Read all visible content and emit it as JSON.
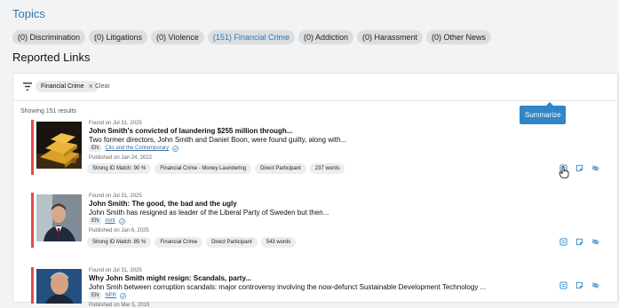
{
  "topics": {
    "title": "Topics",
    "chips": [
      {
        "label": "(0) Discrimination",
        "active": false
      },
      {
        "label": "(0) Litigations",
        "active": false
      },
      {
        "label": "(0) Violence",
        "active": false
      },
      {
        "label": "(151) Financial Crime",
        "active": true
      },
      {
        "label": "(0) Addiction",
        "active": false
      },
      {
        "label": "(0) Harassment",
        "active": false
      },
      {
        "label": "(0) Other News",
        "active": false
      }
    ]
  },
  "links": {
    "title": "Reported Links",
    "filter": {
      "tag": "Financial Crime",
      "clear_label": "Clear"
    },
    "count_text": "Showing 151 results",
    "tooltip": "Summarize",
    "cards": [
      {
        "found": "Found on Jul 31, 2025",
        "title": "John Smith's convicted of laundering $255 million through...",
        "summary": "Two former directors, John Smith and Daniel Boon, were found guilty, along with...",
        "lang": "EN",
        "source": "Clio and the Contemporary",
        "published": "Published on Jan 24, 2022",
        "tags": [
          "Strong ID Match: 90 %",
          "Financial Crime - Money Laundering",
          "Direct Participant",
          "237 words"
        ]
      },
      {
        "found": "Found on Jul 31, 2025",
        "title": "John Smith: The good, the bad and the ugly",
        "summary": "John Smith has resigned as leader of the Liberal Party of Sweden but then...",
        "lang": "EN",
        "source": "mint",
        "published": "Published on Jan 6, 2025",
        "tags": [
          "Strong ID Match: 85 %",
          "Financial Crime",
          "Direct Participant",
          "543 words"
        ]
      },
      {
        "found": "Found on Jul 31, 2025",
        "title": "Why John Smith might resign: Scandals, party...",
        "summary": "John Smih between corruption scandals: major controversy involving the now-defunct Sustainable Development Technology ...",
        "lang": "EN",
        "source": "NPR",
        "published": "Published on Mar 5, 2019",
        "tags": []
      }
    ]
  }
}
